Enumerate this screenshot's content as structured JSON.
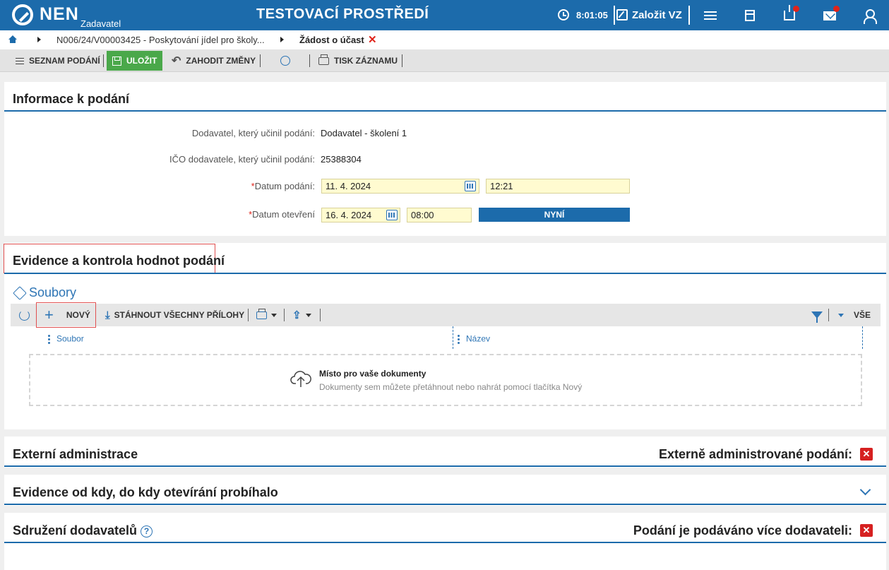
{
  "header": {
    "logo": "NEN",
    "logo_sub": "Zadavatel",
    "environment": "TESTOVACÍ PROSTŘEDÍ",
    "clock": "8:01:05",
    "create_label": "Založit VZ"
  },
  "breadcrumb": {
    "item1": "N006/24/V00003425 - Poskytování jídel pro školy...",
    "current": "Žádost o účast"
  },
  "toolbar": {
    "list_label": "SEZNAM PODÁNÍ",
    "save_label": "ULOŽIT",
    "discard_label": "ZAHODIT ZMĚNY",
    "print_label": "TISK ZÁZNAMU"
  },
  "info": {
    "title": "Informace k podání",
    "supplier_label": "Dodavatel, který učinil podání:",
    "supplier_value": "Dodavatel - školení 1",
    "ico_label": "IČO dodavatele, který učinil podání:",
    "ico_value": "25388304",
    "submit_date_label": "Datum podání:",
    "submit_date": "11. 4. 2024",
    "submit_time": "12:21",
    "open_date_label": "Datum otevření",
    "open_date": "16. 4. 2024",
    "open_time": "08:00",
    "now_label": "NYNÍ"
  },
  "evidence": {
    "title": "Evidence a kontrola hodnot podání",
    "files_title": "Soubory",
    "new_label": "NOVÝ",
    "download_all_label": "STÁHNOUT VŠECHNY PŘÍLOHY",
    "all_label": "VŠE",
    "col_file": "Soubor",
    "col_name": "Název",
    "dropzone_title": "Místo pro vaše dokumenty",
    "dropzone_sub": "Dokumenty sem můžete přetáhnout nebo nahrát pomocí tlačítka Nový"
  },
  "external": {
    "title": "Externí administrace",
    "right_label": "Externě administrované podání:"
  },
  "opening": {
    "title": "Evidence od kdy, do kdy otevírání probíhalo"
  },
  "association": {
    "title": "Sdružení dodavatelů",
    "right_label": "Podání je podáváno více dodavateli:"
  },
  "colors": {
    "brand_blue": "#1c6bab",
    "save_green": "#4aa84a",
    "required_red": "#e0231a",
    "input_yellow": "#fffbd0"
  }
}
